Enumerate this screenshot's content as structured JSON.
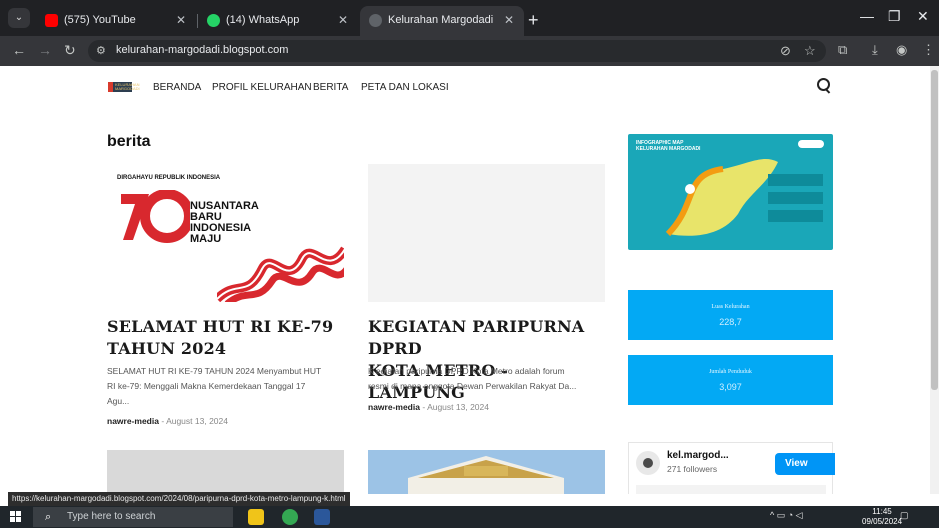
{
  "browser": {
    "tabs": [
      {
        "title": "(575) YouTube",
        "icon": "youtube-icon",
        "color": "#ff0000"
      },
      {
        "title": "(14) WhatsApp",
        "icon": "whatsapp-icon",
        "color": "#25d366"
      },
      {
        "title": "Kelurahan Margodadi",
        "icon": "blank-page-icon",
        "color": "#5f6368"
      }
    ],
    "address": "kelurahan-margodadi.blogspot.com",
    "status_url": "https://kelurahan-margodadi.blogspot.com/2024/08/paripurna-dprd-kota-metro-lampung-k.html"
  },
  "site": {
    "logo_text": "KELURAHAN MARGODADI",
    "nav": [
      "BERANDA",
      "PROFIL KELURAHAN",
      "BERITA",
      "PETA DAN LOKASI"
    ],
    "page_title": "berita",
    "posts": [
      {
        "tagline": "DIRGAHAYU REPUBLIK INDONESIA",
        "number": "79",
        "lines": [
          "NUSANTARA",
          "BARU",
          "INDONESIA",
          "MAJU"
        ],
        "title_l1": "SELAMAT HUT RI KE-79",
        "title_l2": "TAHUN 2024",
        "excerpt_l1": "SELAMAT HUT RI KE-79 TAHUN 2024 Menyambut HUT",
        "excerpt_l2": "RI ke-79: Menggali Makna Kemerdekaan Tanggal 17",
        "excerpt_l3": "Agu...",
        "author": "nawre-media",
        "date": "August 13, 2024"
      },
      {
        "title_l1": "KEGIATAN PARIPURNA DPRD",
        "title_l2": "KOTA METRO - LAMPUNG",
        "excerpt_l1": "K egiatan paripurna DPRD Kota Metro adalah forum",
        "excerpt_l2": "resmi di mana anggota Dewan Perwakilan Rakyat Da...",
        "author": "nawre-media",
        "date": "August 13, 2024"
      }
    ],
    "sidebar": {
      "map_title_l1": "INFOGRAPHIC MAP",
      "map_title_l2": "KELURAHAN MARGODADI",
      "stats": [
        {
          "label": "Luas Kelurahan",
          "value": "228,7"
        },
        {
          "label": "Jumlah Penduduk",
          "value": "3,097"
        }
      ],
      "instagram": {
        "name": "kel.margod...",
        "followers": "271 followers",
        "button": "View profile"
      }
    }
  },
  "taskbar": {
    "search_placeholder": "Type here to search",
    "time": "11:45",
    "date": "09/05/2024"
  },
  "colors": {
    "accent_blue": "#03a9f4",
    "hut_red": "#d8282e",
    "instagram_blue": "#0095f6"
  }
}
